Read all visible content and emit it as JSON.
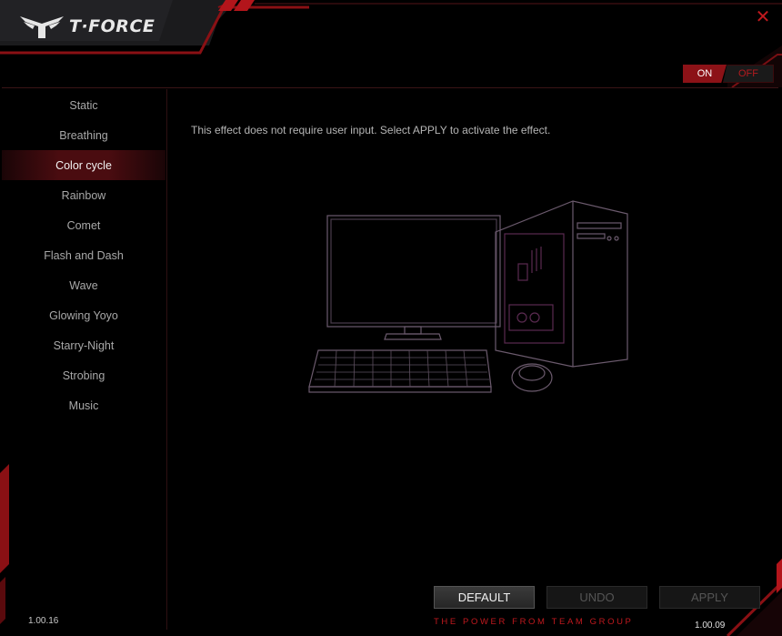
{
  "app": {
    "brand": "T·FORCE",
    "close_glyph": "✕"
  },
  "power": {
    "on_label": "ON",
    "off_label": "OFF",
    "state": "on"
  },
  "sidebar": {
    "items": [
      {
        "label": "Static"
      },
      {
        "label": "Breathing"
      },
      {
        "label": "Color cycle",
        "active": true
      },
      {
        "label": "Rainbow"
      },
      {
        "label": "Comet"
      },
      {
        "label": "Flash and Dash"
      },
      {
        "label": "Wave"
      },
      {
        "label": "Glowing Yoyo"
      },
      {
        "label": "Starry-Night"
      },
      {
        "label": "Strobing"
      },
      {
        "label": "Music"
      }
    ]
  },
  "main": {
    "hint": "This effect does not require user input. Select APPLY to activate the effect."
  },
  "buttons": {
    "default_label": "DEFAULT",
    "undo_label": "UNDO",
    "apply_label": "APPLY"
  },
  "footer": {
    "tagline": "THE POWER FROM TEAM GROUP",
    "version_left": "1.00.16",
    "version_right": "1.00.09"
  },
  "colors": {
    "accent": "#c0191e",
    "active_bg": "#4a0c10",
    "background": "#000000"
  }
}
